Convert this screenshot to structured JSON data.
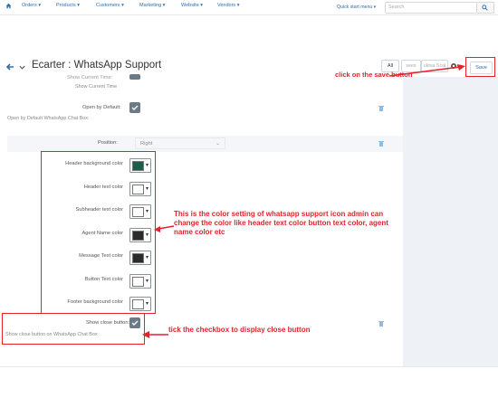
{
  "topnav": {
    "items": [
      "Orders ▾",
      "Products ▾",
      "Customers ▾",
      "Marketing ▾",
      "Website ▾",
      "Vendors ▾"
    ],
    "quick_start": "Quick start menu ▾",
    "search_placeholder": "Search"
  },
  "header": {
    "title": "Ecarter : WhatsApp Support",
    "seg_all": "All",
    "seg_2": "sees",
    "seg_3": "uktsa Scal",
    "save_label": "Save"
  },
  "form": {
    "show_current_time_cut": "Show Current Time:",
    "show_current_time_sub": "Show Current Time",
    "open_default_label": "Open by Default:",
    "open_default_sub": "Open by Default WhatsApp Chat Box",
    "position_label": "Position:",
    "position_value": "Right",
    "colors": [
      {
        "label": "Header background color",
        "color": "#1b5e4a"
      },
      {
        "label": "Header text color",
        "color": "#ffffff"
      },
      {
        "label": "Subheader text color",
        "color": "#ffffff"
      },
      {
        "label": "Agent Name color",
        "color": "#2b2b2b"
      },
      {
        "label": "Message Text color",
        "color": "#2b2b2b"
      },
      {
        "label": "Button Text color",
        "color": "#ffffff"
      },
      {
        "label": "Footer background color",
        "color": "#ffffff"
      }
    ],
    "close_btn_label": "Show close button:",
    "close_btn_sub": "Show close button on WhatsApp Chat Box"
  },
  "annotations": {
    "save": "click on the save button",
    "colors": "This is the color setting of whatsapp support icon admin can change the color like header text color button text color, agent name color etc",
    "close": "tick the checkbox to display close button"
  },
  "colors": {
    "accent": "#2f6fa8",
    "annotation": "#e2232a",
    "checkbox": "#6c7a86"
  }
}
